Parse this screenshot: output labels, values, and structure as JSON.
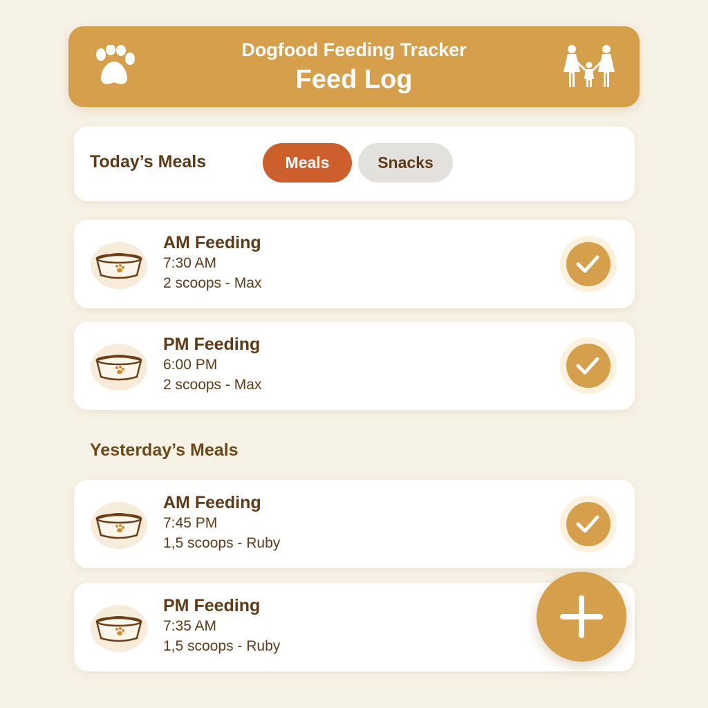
{
  "header": {
    "app_name": "Dogfood Feeding Tracker",
    "title": "Feed Log",
    "left_icon": "paw-icon",
    "right_icon": "family-icon"
  },
  "today": {
    "title": "Today’s Meals",
    "tabs": [
      {
        "label": "Meals",
        "active": true
      },
      {
        "label": "Snacks",
        "active": false
      }
    ],
    "meals": [
      {
        "name": "AM Feeding",
        "time": "7:30 AM",
        "amount": "2 scoops - Max",
        "done": true
      },
      {
        "name": "PM Feeding",
        "time": "6:00 PM",
        "amount": "2 scoops - Max",
        "done": true
      }
    ]
  },
  "yesterday": {
    "title": "Yesterday’s Meals",
    "meals": [
      {
        "name": "AM Feeding",
        "time": "7:45 PM",
        "amount": "1,5 scoops - Ruby",
        "done": true
      },
      {
        "name": "PM Feeding",
        "time": "7:35 AM",
        "amount": "1,5 scoops - Ruby",
        "done": false
      }
    ]
  },
  "fab": {
    "icon": "plus-icon"
  },
  "colors": {
    "background": "#f7f2e6",
    "accent": "#d59f4b",
    "active_tab": "#cd5f2c",
    "inactive_tab": "#e3e1dd",
    "text": "#5e3a17"
  }
}
